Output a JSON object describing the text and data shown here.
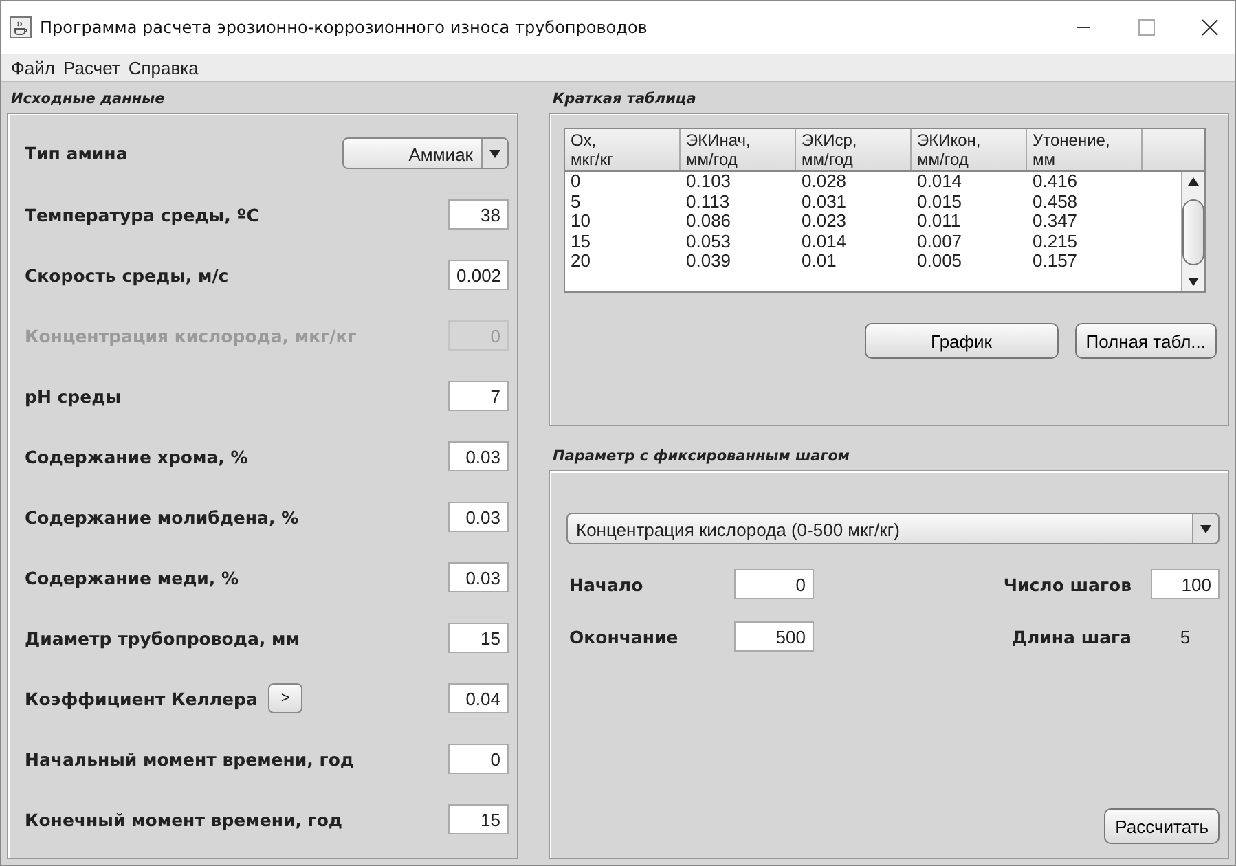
{
  "window": {
    "title": "Программа расчета эрозионно-коррозионного износа трубопроводов"
  },
  "menu": [
    "Файл",
    "Расчет",
    "Справка"
  ],
  "inputs": {
    "title": "Исходные данные",
    "fields": [
      {
        "kind": "select",
        "label": "Тип амина",
        "value": "Аммиак",
        "disabled": false
      },
      {
        "kind": "input",
        "label": "Температура среды, ºС",
        "value": "38",
        "disabled": false
      },
      {
        "kind": "input",
        "label": "Скорость среды, м/с",
        "value": "0.002",
        "disabled": false
      },
      {
        "kind": "input",
        "label": "Концентрация кислорода, мкг/кг",
        "value": "0",
        "disabled": true
      },
      {
        "kind": "input",
        "label": "pH среды",
        "value": "7",
        "disabled": false
      },
      {
        "kind": "input",
        "label": "Содержание хрома, %",
        "value": "0.03",
        "disabled": false
      },
      {
        "kind": "input",
        "label": "Содержание молибдена, %",
        "value": "0.03",
        "disabled": false
      },
      {
        "kind": "input",
        "label": "Содержание меди, %",
        "value": "0.03",
        "disabled": false
      },
      {
        "kind": "input",
        "label": "Диаметр трубопровода, мм",
        "value": "15",
        "disabled": false
      },
      {
        "kind": "input",
        "label": "Коэффициент Келлера",
        "button": ">",
        "value": "0.04",
        "disabled": false
      },
      {
        "kind": "input",
        "label": "Начальный момент времени, год",
        "value": "0",
        "disabled": false
      },
      {
        "kind": "input",
        "label": "Конечный момент времени, год",
        "value": "15",
        "disabled": false
      }
    ]
  },
  "summary": {
    "title": "Краткая таблица",
    "columns": [
      "Ох,\nмкг/кг",
      "ЭКИнач,\nмм/год",
      "ЭКИср,\nмм/год",
      "ЭКИкон,\nмм/год",
      "Утонение,\nмм"
    ],
    "rows": [
      [
        "0",
        "0.103",
        "0.028",
        "0.014",
        "0.416"
      ],
      [
        "5",
        "0.113",
        "0.031",
        "0.015",
        "0.458"
      ],
      [
        "10",
        "0.086",
        "0.023",
        "0.011",
        "0.347"
      ],
      [
        "15",
        "0.053",
        "0.014",
        "0.007",
        "0.215"
      ],
      [
        "20",
        "0.039",
        "0.01",
        "0.005",
        "0.157"
      ]
    ],
    "buttons": [
      "График",
      "Полная табл..."
    ]
  },
  "step": {
    "title": "Параметр с фиксированным шагом",
    "parameter": "Концентрация кислорода (0-500 мкг/кг)",
    "start_label": "Начало",
    "start": "0",
    "end_label": "Окончание",
    "end": "500",
    "steps_label": "Число шагов",
    "steps": "100",
    "length_label": "Длина шага",
    "length": "5",
    "button": "Рассчитать"
  }
}
